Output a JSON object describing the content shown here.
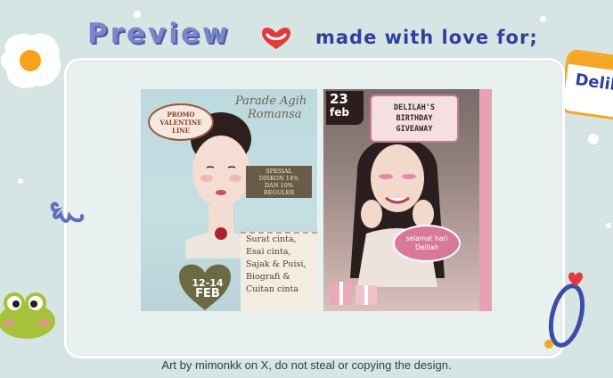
{
  "header": {
    "preview_label": "Preview",
    "made_with_love_label": "made with love for;"
  },
  "name_tag": {
    "text": "Delil"
  },
  "left_poster": {
    "promo_lines": [
      "PROMO",
      "VALENTINE",
      "LINE"
    ],
    "title_lines": [
      "Parade Agih",
      "Romansa"
    ],
    "sale_lines": [
      "SPESIAL",
      "DISKON 14%",
      "DAN 10%",
      "REGULER"
    ],
    "date_line1": "12-14",
    "date_line2": "FEB",
    "letter_items": [
      "Surat cinta,",
      "Esai cinta,",
      "Sajak & Puisi,",
      "Biografi &",
      "Cuitan cinta"
    ]
  },
  "right_poster": {
    "day_line1": "23",
    "day_line2": "feb",
    "giveaway_lines": [
      "DELILAH'S",
      "BIRTHDAY",
      "GIVEAWAY"
    ],
    "bubble_lines": [
      "selamat hari",
      "Delilah"
    ]
  },
  "footer": {
    "credit": "Art by mimonkk on X, do not steal or copying the design."
  },
  "colors": {
    "background": "#d6e5e3",
    "preview_title": "#7a86c9",
    "subtitle": "#2f3f9e",
    "heart": "#e23a3a",
    "accent_pink": "#e7a1b3"
  },
  "icons": [
    "fried-egg-icon",
    "heart-icon",
    "ribbon-icon",
    "frog-icon",
    "ring-icon"
  ]
}
